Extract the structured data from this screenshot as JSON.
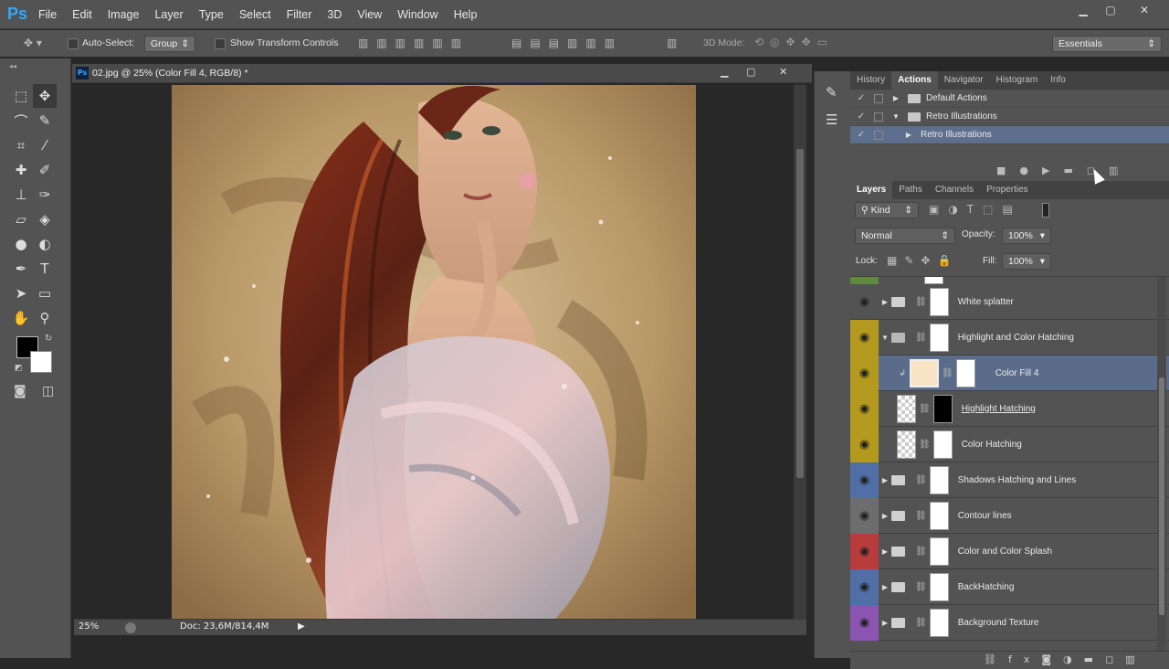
{
  "app": {
    "logo": "Ps"
  },
  "menu": [
    "File",
    "Edit",
    "Image",
    "Layer",
    "Type",
    "Select",
    "Filter",
    "3D",
    "View",
    "Window",
    "Help"
  ],
  "window_controls": {
    "minimize": "▁",
    "maximize": "▢",
    "close": "✕"
  },
  "options": {
    "auto_select_label": "Auto-Select:",
    "auto_select_value": "Group",
    "transform_label": "Show Transform Controls",
    "mode_3d_label": "3D Mode:",
    "workspace": "Essentials"
  },
  "document": {
    "tab_title": "02.jpg @ 25% (Color Fill 4, RGB/8) *",
    "zoom": "25%",
    "doc_size": "Doc: 23,6M/814,4M",
    "tab_icon": "Ps"
  },
  "top_panel": {
    "tabs": [
      "History",
      "Actions",
      "Navigator",
      "Histogram",
      "Info"
    ],
    "active_tab": "Actions",
    "actions": [
      {
        "label": "Default Actions"
      },
      {
        "label": "Retro Illustrations"
      },
      {
        "label": "Retro Illustrations"
      }
    ]
  },
  "layers_panel": {
    "tabs": [
      "Layers",
      "Paths",
      "Channels",
      "Properties"
    ],
    "active_tab": "Layers",
    "filter_kind": "Kind",
    "blend_mode": "Normal",
    "opacity_label": "Opacity:",
    "opacity_value": "100%",
    "lock_label": "Lock:",
    "fill_label": "Fill:",
    "fill_value": "100%",
    "layers": [
      {
        "name": "White splatter",
        "color": "#535353",
        "type": "group"
      },
      {
        "name": "Highlight and Color Hatching",
        "color": "#b39a1e",
        "type": "group-open"
      },
      {
        "name": "Color Fill 4",
        "color": "#b39a1e",
        "type": "fill",
        "selected": true
      },
      {
        "name": "Highlight Hatching",
        "color": "#b39a1e",
        "type": "layer-mask"
      },
      {
        "name": "Color Hatching",
        "color": "#b39a1e",
        "type": "layer"
      },
      {
        "name": "Shadows Hatching and Lines",
        "color": "#4f6fa6",
        "type": "group"
      },
      {
        "name": "Contour lines",
        "color": "#6d6d6d",
        "type": "group"
      },
      {
        "name": "Color and Color Splash",
        "color": "#b93c3c",
        "type": "group"
      },
      {
        "name": "BackHatching",
        "color": "#4f6fa6",
        "type": "group"
      },
      {
        "name": "Background Texture",
        "color": "#8a54b0",
        "type": "group"
      }
    ]
  },
  "colors": {
    "fill_swatch": "#f9e5c6",
    "selected_row": "#5b6c8a",
    "accent": "#31a8ff"
  }
}
